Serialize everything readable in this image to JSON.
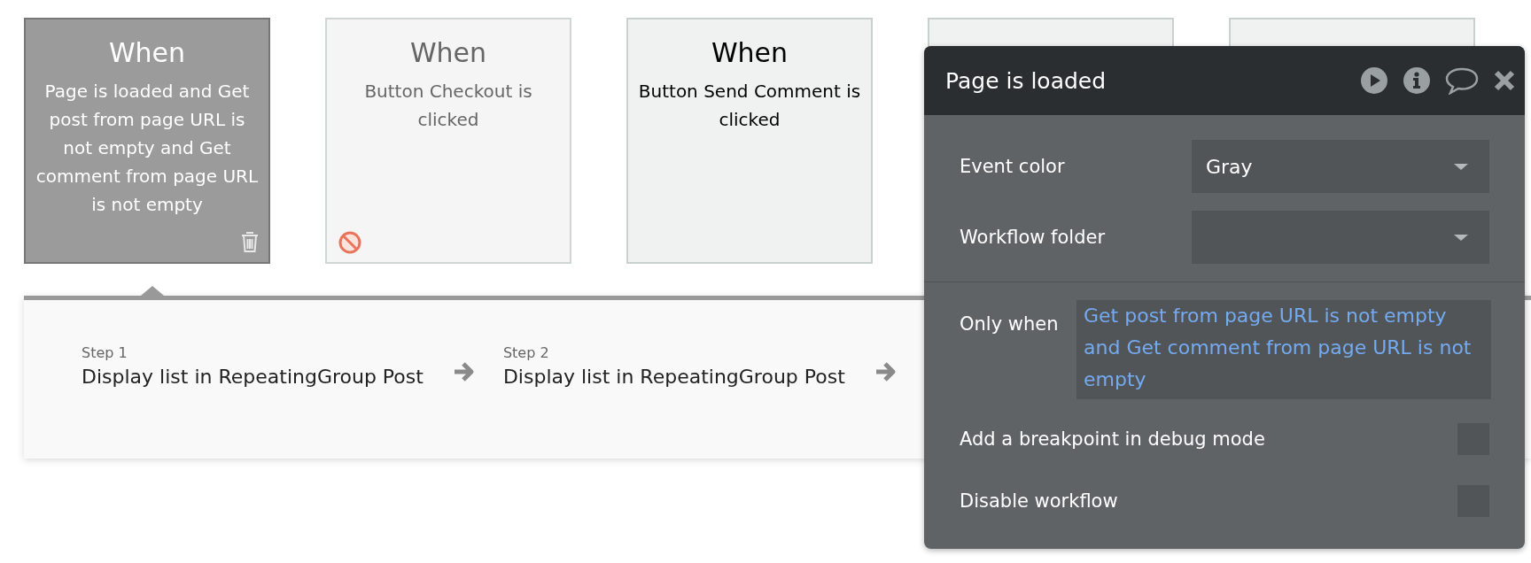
{
  "cards": [
    {
      "heading": "When",
      "description": "Page is loaded and Get post from page URL is not empty and Get comment from page URL is not empty",
      "selected": true,
      "disabled": false
    },
    {
      "heading": "When",
      "description": "Button Checkout is clicked",
      "selected": false,
      "disabled": true
    },
    {
      "heading": "When",
      "description": "Button Send Comment is clicked",
      "selected": false,
      "disabled": false
    },
    {
      "selected": false
    },
    {
      "selected": false
    }
  ],
  "steps": [
    {
      "label": "Step 1",
      "action": "Display list in RepeatingGroup Post"
    },
    {
      "label": "Step 2",
      "action": "Display list in RepeatingGroup Post"
    }
  ],
  "panel": {
    "title": "Page is loaded",
    "fields": [
      {
        "kind": "select",
        "label": "Event color",
        "value": "Gray"
      },
      {
        "kind": "select",
        "label": "Workflow folder"
      },
      {
        "kind": "expression",
        "label": "Only when",
        "value": "Get post from page URL is not empty and Get comment from page URL is not empty"
      },
      {
        "kind": "checkbox",
        "label": "Add a breakpoint in debug mode",
        "checked": false
      },
      {
        "kind": "checkbox",
        "label": "Disable workflow",
        "checked": false
      }
    ]
  }
}
